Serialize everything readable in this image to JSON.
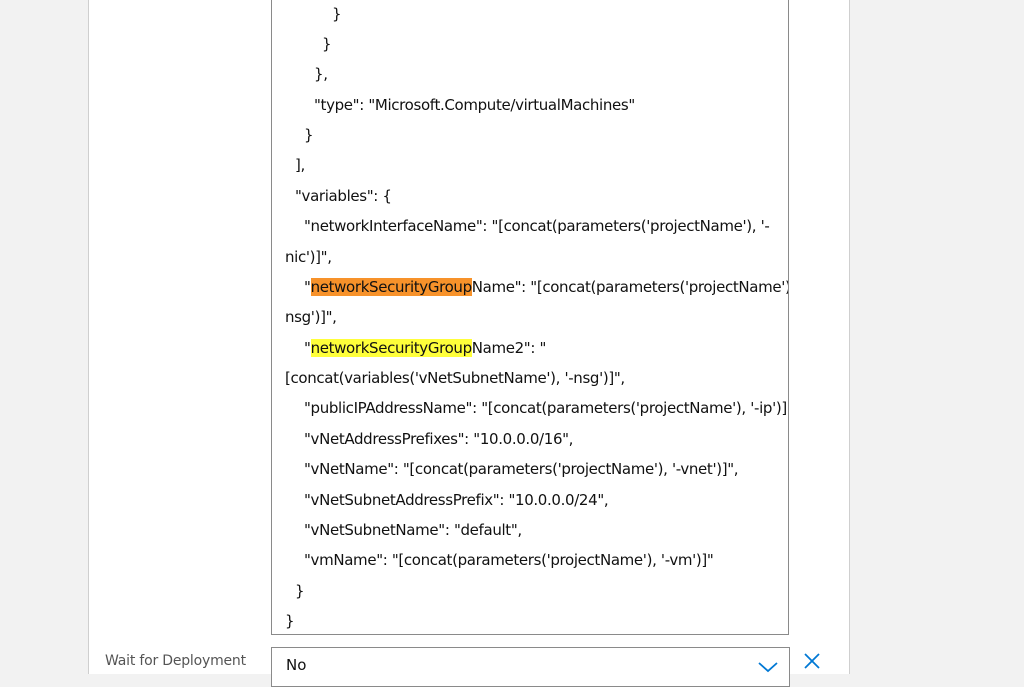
{
  "editor": {
    "lines": [
      "}",
      "}",
      "},",
      "\"type\": \"Microsoft.Compute/virtualMachines\"",
      "}",
      "],",
      "\"variables\": {",
      "\"networkInterfaceName\": \"[concat(parameters('projectName'), '-",
      "nic')]\",",
      "Name\": \"[concat(parameters('projectName'), '-",
      "nsg')]\",",
      "Name2\": \"",
      "[concat(variables('vNetSubnetName'), '-nsg')]\",",
      "\"publicIPAddressName\": \"[concat(parameters('projectName'), '-ip')]\",",
      "\"vNetAddressPrefixes\": \"10.0.0.0/16\",",
      "\"vNetName\": \"[concat(parameters('projectName'), '-vnet')]\",",
      "\"vNetSubnetAddressPrefix\": \"10.0.0.0/24\",",
      "\"vNetSubnetName\": \"default\",",
      "\"vmName\": \"[concat(parameters('projectName'), '-vm')]\"",
      "}",
      "}"
    ],
    "quote": "\"",
    "highlight_term": "networkSecurityGroup",
    "highlight_colors": {
      "current": "#f7922a",
      "other": "#ffff3a"
    }
  },
  "wait_for_deployment": {
    "label": "Wait for Deployment",
    "value": "No"
  },
  "icons": {
    "dropdown": "chevron-down-icon",
    "remove": "close-icon"
  },
  "colors": {
    "accent": "#0078d4"
  }
}
